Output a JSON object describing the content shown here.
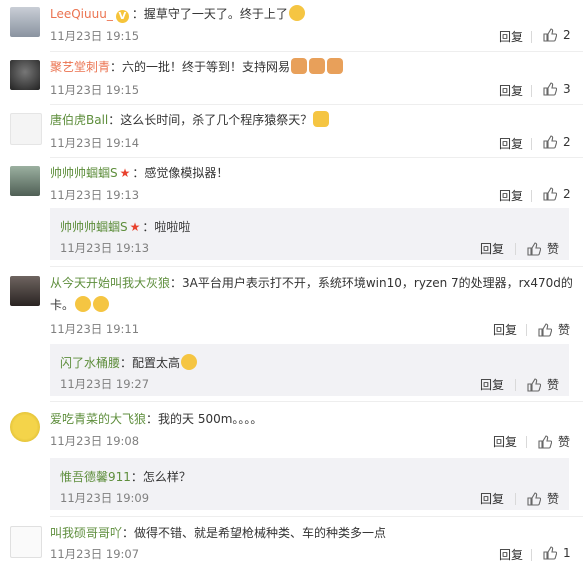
{
  "comments": [
    {
      "user": "LeeQiuuu_",
      "text": "：握草守了一天了。终于上了",
      "time": "11月23日 19:15",
      "reply": "回复",
      "likes": "2",
      "badge": "V"
    },
    {
      "user": "聚艺堂刺青",
      "text": "：六的一批！终于等到！支持网易",
      "time": "11月23日 19:15",
      "reply": "回复",
      "likes": "3"
    },
    {
      "user": "唐伯虎Ball",
      "text": "：这么长时间，杀了几个程序猿祭天？",
      "time": "11月23日 19:14",
      "reply": "回复",
      "likes": "2"
    },
    {
      "user": "帅帅帅蝈蝈S",
      "text": "：感觉像模拟器！",
      "time": "11月23日 19:13",
      "reply": "回复",
      "likes": "2",
      "sub": {
        "user": "帅帅帅蝈蝈S",
        "text": "：啦啦啦",
        "time": "11月23日 19:13",
        "reply": "回复",
        "like": "赞"
      }
    },
    {
      "user": "从今天开始叫我大灰狼",
      "text": "：3A平台用户表示打不开，系统环境win10，ryzen 7的处理器，rx470d的",
      "text2": "卡。",
      "time": "11月23日 19:11",
      "reply": "回复",
      "like": "赞",
      "sub": {
        "user": "闪了水桶腰",
        "text": "：配置太高",
        "time": "11月23日 19:27",
        "reply": "回复",
        "like": "赞"
      }
    },
    {
      "user": "爱吃青菜的大飞狼",
      "text": "：我的天  500m。。。。",
      "time": "11月23日 19:08",
      "reply": "回复",
      "like": "赞",
      "sub": {
        "user": "惟吾德馨911",
        "text": "：怎么样？",
        "time": "11月23日 19:09",
        "reply": "回复",
        "like": "赞"
      }
    },
    {
      "user": "叫我硕哥哥吖",
      "text": "：做得不错、就是希望枪械种类、车的种类多一点",
      "time": "11月23日 19:07",
      "reply": "回复",
      "likes": "1"
    }
  ],
  "colors": {
    "username": "#eb7350",
    "username_alt": "#5e8e3c",
    "time": "#808080",
    "sub_bg": "#f2f2f5"
  }
}
